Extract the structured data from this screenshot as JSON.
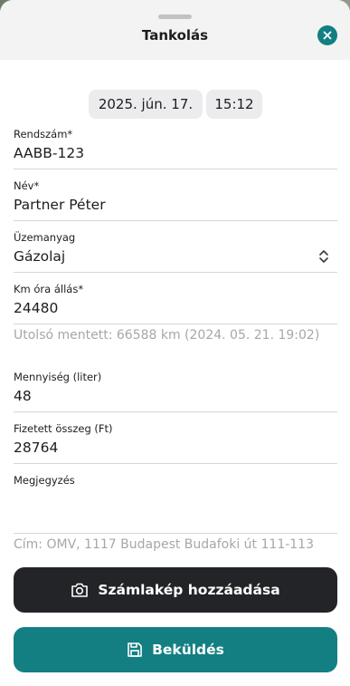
{
  "header": {
    "title": "Tankolás"
  },
  "datetime": {
    "date": "2025. jún. 17.",
    "time": "15:12"
  },
  "form": {
    "plate": {
      "label": "Rendszám*",
      "value": "AABB-123"
    },
    "name": {
      "label": "Név*",
      "value": "Partner Péter"
    },
    "fuel": {
      "label": "Üzemanyag",
      "value": "Gázolaj"
    },
    "odometer": {
      "label": "Km óra állás*",
      "value": "24480"
    },
    "odometer_hint": "Utolsó mentett: 66588 km (2024. 05. 21. 19:02)",
    "quantity": {
      "label": "Mennyiség (liter)",
      "value": "48"
    },
    "amount": {
      "label": "Fizetett összeg (Ft)",
      "value": "28764"
    },
    "note": {
      "label": "Megjegyzés",
      "value": ""
    },
    "address_hint": "Cím: OMV, 1117 Budapest Budafoki út 111-113"
  },
  "actions": {
    "add_receipt_label": "Számlakép hozzáadása",
    "submit_label": "Beküldés"
  },
  "icons": {
    "close": "close-icon",
    "chevrons": "chevron-up-down-icon",
    "camera": "camera-icon",
    "save": "save-icon"
  },
  "colors": {
    "accent": "#137f83",
    "dark_button": "#232427",
    "hint_text": "#a7a7ab"
  }
}
